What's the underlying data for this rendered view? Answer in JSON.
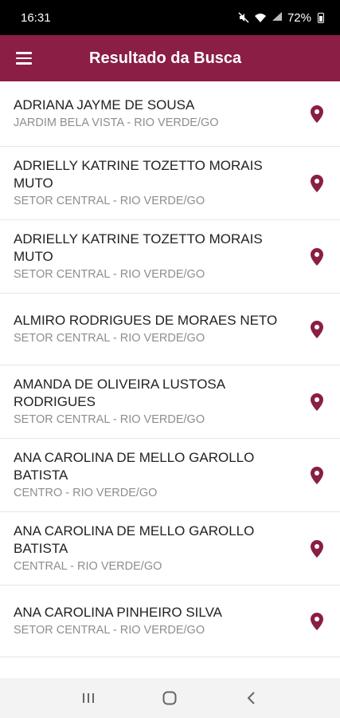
{
  "status_bar": {
    "time": "16:31",
    "icons": [
      "mute-icon",
      "wifi-icon",
      "signal-icon",
      "battery-icon"
    ],
    "battery": "72%"
  },
  "app_bar": {
    "title": "Resultado da Busca",
    "color": "#8a1e45"
  },
  "results": [
    {
      "name_line1": "ADRIANA JAYME DE SOUSA",
      "name_line2": "",
      "location": "JARDIM BELA VISTA - RIO VERDE/GO"
    },
    {
      "name_line1": "ADRIELLY KATRINE TOZETTO MORAIS",
      "name_line2": "MUTO",
      "location": "SETOR CENTRAL - RIO VERDE/GO"
    },
    {
      "name_line1": "ADRIELLY KATRINE TOZETTO MORAIS",
      "name_line2": "MUTO",
      "location": "SETOR CENTRAL - RIO VERDE/GO"
    },
    {
      "name_line1": "ALMIRO RODRIGUES DE MORAES NETO",
      "name_line2": "",
      "location": "SETOR CENTRAL - RIO VERDE/GO"
    },
    {
      "name_line1": "AMANDA DE OLIVEIRA LUSTOSA",
      "name_line2": "RODRIGUES",
      "location": "SETOR CENTRAL - RIO VERDE/GO"
    },
    {
      "name_line1": "ANA CAROLINA DE MELLO GAROLLO",
      "name_line2": "BATISTA",
      "location": "CENTRO - RIO VERDE/GO"
    },
    {
      "name_line1": "ANA CAROLINA DE MELLO GAROLLO",
      "name_line2": "BATISTA",
      "location": "CENTRAL - RIO VERDE/GO"
    },
    {
      "name_line1": "ANA CAROLINA PINHEIRO SILVA",
      "name_line2": "",
      "location": "SETOR CENTRAL - RIO VERDE/GO"
    }
  ],
  "nav_bar": {
    "buttons": [
      "recent-apps-icon",
      "home-icon",
      "back-icon"
    ]
  }
}
